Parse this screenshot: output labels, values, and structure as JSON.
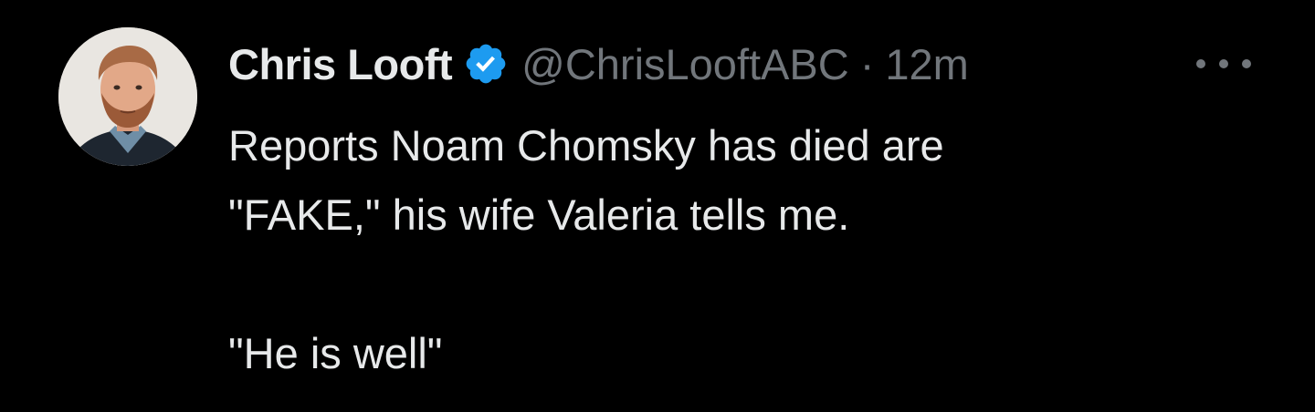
{
  "author": {
    "display_name": "Chris Looft",
    "handle": "@ChrisLooftABC",
    "verified": true,
    "avatar_icon": "avatar-photo"
  },
  "meta": {
    "separator": "·",
    "time": "12m"
  },
  "tweet": {
    "lines": [
      "Reports Noam Chomsky has died are",
      "\"FAKE,\" his wife Valeria tells me."
    ],
    "quote": "\"He is well\""
  },
  "colors": {
    "background": "#000000",
    "primary_text": "#e7e9ea",
    "secondary_text": "#71767b",
    "verified_blue": "#1d9bf0"
  },
  "icons": {
    "verified": "verified-badge-icon",
    "more": "more-options-icon"
  }
}
